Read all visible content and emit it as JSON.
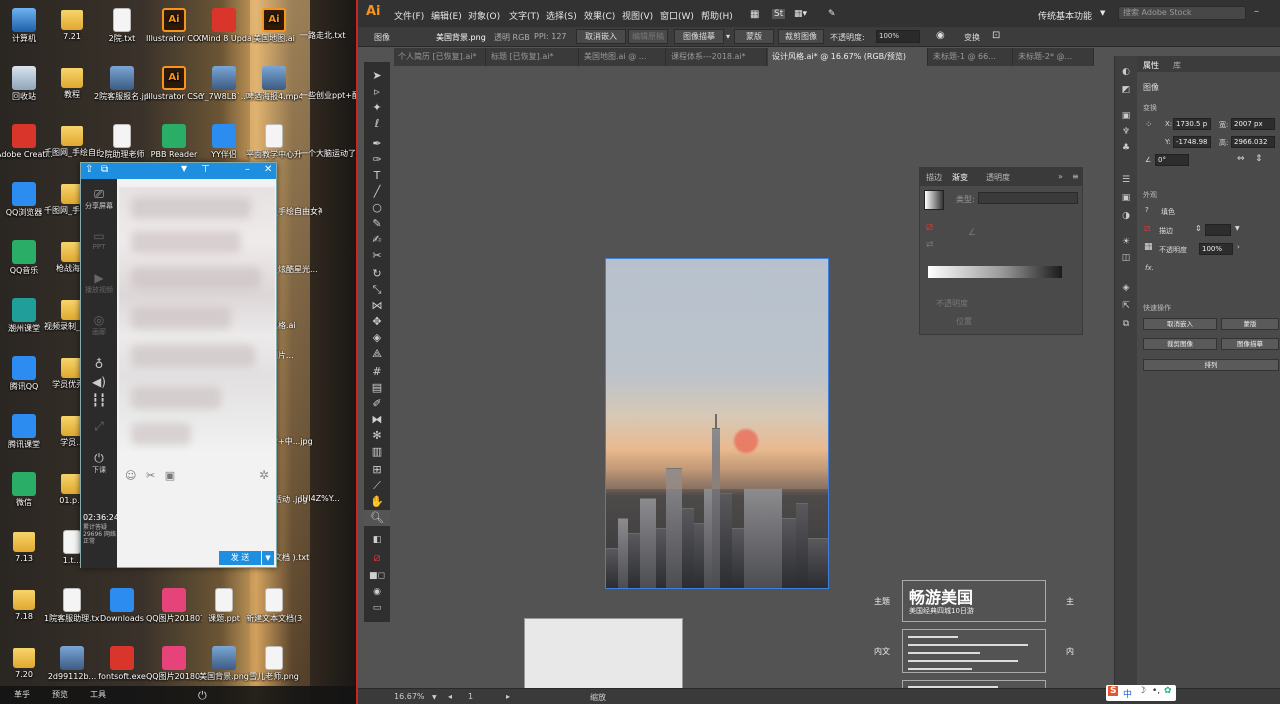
{
  "desktop": {
    "icons": [
      {
        "label": "计算机",
        "kind": "pc"
      },
      {
        "label": "7.21",
        "kind": "folder"
      },
      {
        "label": "2院.txt",
        "kind": "doc"
      },
      {
        "label": "Illustrator CC 2018",
        "kind": "ai"
      },
      {
        "label": "XMind 8 Update 2",
        "kind": "red"
      },
      {
        "label": "美国地图.ai",
        "kind": "ai"
      },
      {
        "label": "回收站",
        "kind": "recycle"
      },
      {
        "label": "教程",
        "kind": "folder"
      },
      {
        "label": "2院客服报名.jpg",
        "kind": "img"
      },
      {
        "label": "Illustrator CS6",
        "kind": "ai"
      },
      {
        "label": "Y_7W8LB`...",
        "kind": "img"
      },
      {
        "label": "啤酒海报4.mp4",
        "kind": "img"
      },
      {
        "label": "Adobe Creati...",
        "kind": "red"
      },
      {
        "label": "千图网_手绘自由女神...",
        "kind": "folder"
      },
      {
        "label": "2院助理老师",
        "kind": "doc"
      },
      {
        "label": "PBB Reader",
        "kind": "green"
      },
      {
        "label": "YY伴侣",
        "kind": "blue"
      },
      {
        "label": "平面教学中心升级...",
        "kind": "doc"
      },
      {
        "label": "QQ浏览器",
        "kind": "blue"
      },
      {
        "label": "千图网_手绘光效里...",
        "kind": "folder"
      },
      {
        "label": "QQ音乐",
        "kind": "green"
      },
      {
        "label": "枪战海报",
        "kind": "folder"
      },
      {
        "label": "潮州课堂",
        "kind": "teal"
      },
      {
        "label": "视频录制_20180...",
        "kind": "folder"
      },
      {
        "label": "腾讯QQ",
        "kind": "blue"
      },
      {
        "label": "学员优秀...",
        "kind": "folder"
      },
      {
        "label": "腾讯课堂",
        "kind": "blue"
      },
      {
        "label": "学员...",
        "kind": "folder"
      },
      {
        "label": "微信",
        "kind": "green"
      },
      {
        "label": "01.p...",
        "kind": "folder"
      },
      {
        "label": "7.13",
        "kind": "folder"
      },
      {
        "label": "1.t...",
        "kind": "doc"
      },
      {
        "label": "7.18",
        "kind": "folder"
      },
      {
        "label": "1院客服助理.txt",
        "kind": "doc"
      },
      {
        "label": "Downloads",
        "kind": "blue"
      },
      {
        "label": "QQ图片20180724...",
        "kind": "pink"
      },
      {
        "label": "课题.ppt",
        "kind": "doc"
      },
      {
        "label": "新建文本文档(3).txt",
        "kind": "doc"
      },
      {
        "label": "7.20",
        "kind": "folder"
      },
      {
        "label": "2d99112b...",
        "kind": "img"
      },
      {
        "label": "fontsoft.exe",
        "kind": "red"
      },
      {
        "label": "QQ图片20180724...",
        "kind": "pink"
      },
      {
        "label": "美国背景.png",
        "kind": "img"
      },
      {
        "label": "雪儿老师.png",
        "kind": "doc"
      }
    ],
    "right_labels": [
      "一路走北.txt",
      "一些创业ppt+配乐2.pptx",
      "一个大脑运动了2.ai",
      "花_手绘自由女神像...",
      "图_炫酷星光...",
      "风格.ai",
      "图片...",
      "堂+中...jpg",
      "JUI4Z%Y...",
      "年活动 .jpg",
      "本文档 ).txt"
    ],
    "taskbar": {
      "left": "革乎",
      "middle": "预览",
      "tools": "工具"
    }
  },
  "qq_panel": {
    "sidebar": [
      "分享屏幕",
      "PPT",
      "播放视频",
      "画廊",
      "摄像头"
    ],
    "exit_label": "下课",
    "timer": "02:36:24",
    "stats": "累计答疑 29696 网络正常",
    "send_label": "发 送"
  },
  "illustrator": {
    "logo": "Ai",
    "menu": [
      "文件(F)",
      "编辑(E)",
      "对象(O)",
      "文字(T)",
      "选择(S)",
      "效果(C)",
      "视图(V)",
      "窗口(W)",
      "帮助(H)"
    ],
    "st_badge": "St",
    "workspace": "传统基本功能",
    "stock_search": "搜索 Adobe Stock",
    "control": {
      "kind": "图像",
      "filename": "美国背景.png",
      "mode": "透明 RGB",
      "ppi": "PPI: 127",
      "unembed": "取消嵌入",
      "edit_original": "编辑原稿",
      "image_trace": "图像描摹",
      "mask": "蒙版",
      "crop": "裁剪图像",
      "opacity_label": "不透明度:",
      "opacity": "100%",
      "transform": "变换"
    },
    "tabs": [
      "个人简历 [已恢复].ai*",
      "标题 [已恢复].ai*",
      "美国地图.ai @ ...",
      "课程体系---2018.ai*",
      "设计风格.ai* @ 16.67% (RGB/预览)",
      "未标题-1 @ 66...",
      "未标题-2* @..."
    ],
    "active_tab_index": 4,
    "gradient_panel": {
      "tabs": [
        "描边",
        "渐变",
        "透明度"
      ],
      "type_label": "类型:",
      "opacity_label": "不透明度",
      "position_label": "位置"
    },
    "properties": {
      "tabs": [
        "属性",
        "库"
      ],
      "object": "图像",
      "transform_label": "变换",
      "x": "1730.5 p",
      "y": "-1748.98",
      "w": "2007 px",
      "h": "2966.032",
      "angle": "0°",
      "appearance_label": "外观",
      "fill_label": "填色",
      "stroke_label": "描边",
      "opacity_label": "不透明度",
      "opacity": "100%",
      "fx": "fx.",
      "quick_actions_label": "快速操作",
      "btn_unembed": "取消嵌入",
      "btn_mask": "蒙版",
      "btn_crop": "裁剪图像",
      "btn_trace": "图像描摹",
      "btn_arrange": "排列"
    },
    "pasteboard": {
      "theme_label": "主题",
      "body_label": "内文",
      "theme_label_right": "主",
      "body_label_right": "内",
      "headline": "畅游美国",
      "subheadline": "美国经典四城10日游"
    },
    "status": {
      "zoom": "16.67%",
      "artboard": "1",
      "mode": "缩放"
    },
    "ime": "中"
  }
}
